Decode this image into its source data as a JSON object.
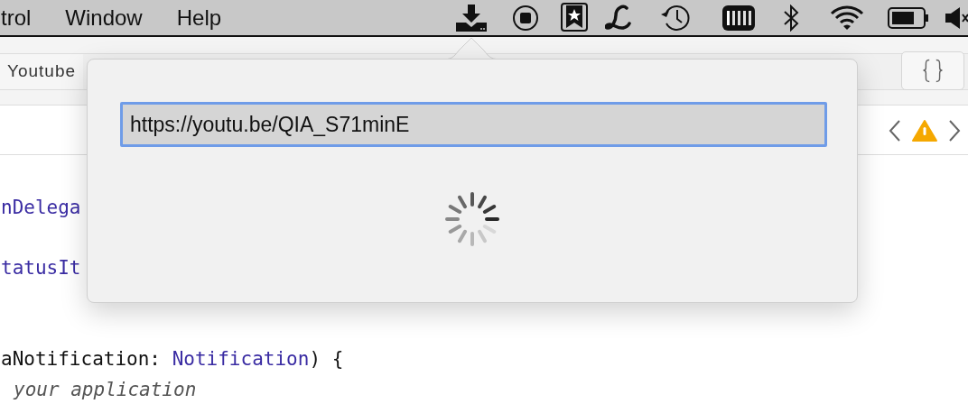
{
  "menu_bar": {
    "items": [
      "trol",
      "Window",
      "Help"
    ]
  },
  "editor": {
    "tab": {
      "label": "Youtube",
      "selected": true
    },
    "code_lines": [
      {
        "tokens": [
          {
            "text": "nDelega",
            "kind": "type"
          }
        ]
      },
      {
        "tokens": [
          {
            "text": "tatusIt",
            "kind": "type"
          }
        ]
      },
      {
        "tokens": [
          {
            "text": "aNotification: ",
            "kind": "plain"
          },
          {
            "text": "Notification",
            "kind": "type"
          },
          {
            "text": ") {",
            "kind": "plain"
          }
        ]
      },
      {
        "tokens": [
          {
            "text": "your application",
            "kind": "comment"
          }
        ]
      }
    ]
  },
  "popover": {
    "url_field": {
      "value": "https://youtu.be/QIA_S71minE",
      "focused": true
    },
    "loading": true
  }
}
